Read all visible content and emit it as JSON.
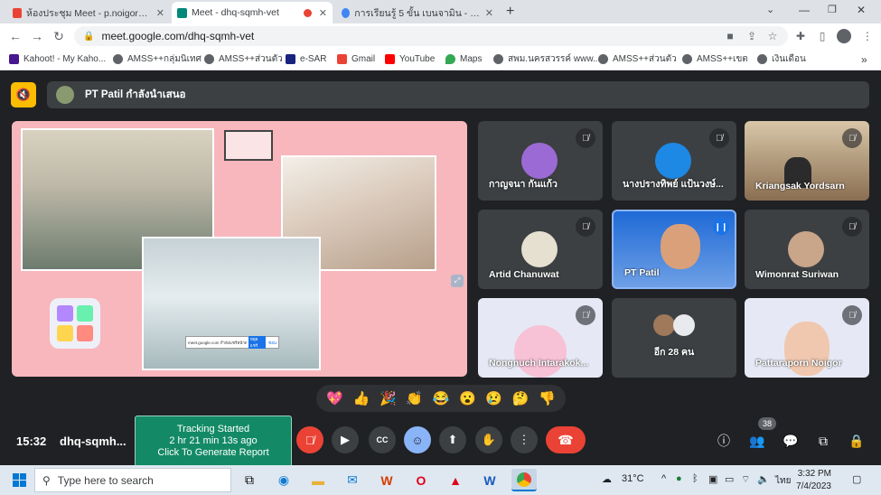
{
  "browser": {
    "tabs": [
      {
        "title": "ห้องประชุม Meet - p.noigor@gmai",
        "icon": "gmail-icon",
        "color": "#ea4335"
      },
      {
        "title": "Meet - dhq-sqmh-vet",
        "icon": "meet-icon",
        "color": "#00897b"
      },
      {
        "title": "การเรียนรู้ 5 ขั้น เบนจามิน - Google S",
        "icon": "google-icon",
        "color": "#4285f4"
      }
    ],
    "url": "meet.google.com/dhq-sqmh-vet",
    "bookmarks": [
      {
        "label": "Kahoot! - My Kaho...",
        "color": "#46178f"
      },
      {
        "label": "AMSS++กลุ่มนิเทศ",
        "color": "#5f6368"
      },
      {
        "label": "AMSS++ส่วนตัว",
        "color": "#5f6368"
      },
      {
        "label": "e-SAR",
        "color": "#1a237e"
      },
      {
        "label": "Gmail",
        "color": "#ea4335"
      },
      {
        "label": "YouTube",
        "color": "#ff0000"
      },
      {
        "label": "Maps",
        "color": "#34a853"
      },
      {
        "label": "สพม.นครสวรรค์ www....",
        "color": "#5f6368"
      },
      {
        "label": "AMSS++ส่วนตัว",
        "color": "#5f6368"
      },
      {
        "label": "AMSS++เขต",
        "color": "#5f6368"
      },
      {
        "label": "เงินเดือน",
        "color": "#5f6368"
      }
    ]
  },
  "meet": {
    "presenter_text": "PT Patil กำลังนำเสนอ",
    "participants": [
      {
        "name": "กาญจนา กันแก้ว",
        "type": "avatar",
        "color": "#9c6ad4"
      },
      {
        "name": "นางปรางทิพย์ แป้นวงษ์...",
        "type": "avatar",
        "color": "#1e88e5"
      },
      {
        "name": "Kriangsak Yordsarn",
        "type": "video",
        "color": "#7a5a3a"
      },
      {
        "name": "Artid Chanuwat",
        "type": "photo",
        "color": "#e6e0d0"
      },
      {
        "name": "PT Patil",
        "type": "video",
        "color": "#1f6ad6"
      },
      {
        "name": "Wimonrat Suriwan",
        "type": "photo",
        "color": "#c9a58a"
      },
      {
        "name": "Nongnuch Intarakok...",
        "type": "video",
        "color": "#e6e9f5"
      },
      {
        "name": "อีก 28 คน",
        "type": "group",
        "color": "#3c4043"
      },
      {
        "name": "Pattaraporn Noigor",
        "type": "video",
        "color": "#e6e9f5"
      }
    ],
    "reactions": [
      "💖",
      "👍",
      "🎉",
      "👏",
      "😂",
      "😮",
      "😢",
      "🤔",
      "👎"
    ],
    "clock": "15:32",
    "meeting_code": "dhq-sqmh...",
    "tracking": {
      "line1": "Tracking Started",
      "line2": "2 hr 21 min 13s ago",
      "line3": "Click To Generate Report"
    },
    "participant_count": "38",
    "slide_caption": "meet.google.com กำลังแชร์หน้าต่างของคุณ",
    "slide_stop_label": "หยุดแชร์",
    "slide_hide_label": "ซ่อน"
  },
  "taskbar": {
    "search_placeholder": "Type here to search",
    "temperature": "31°C",
    "language": "ไทย",
    "time": "3:32 PM",
    "date": "7/4/2023"
  }
}
